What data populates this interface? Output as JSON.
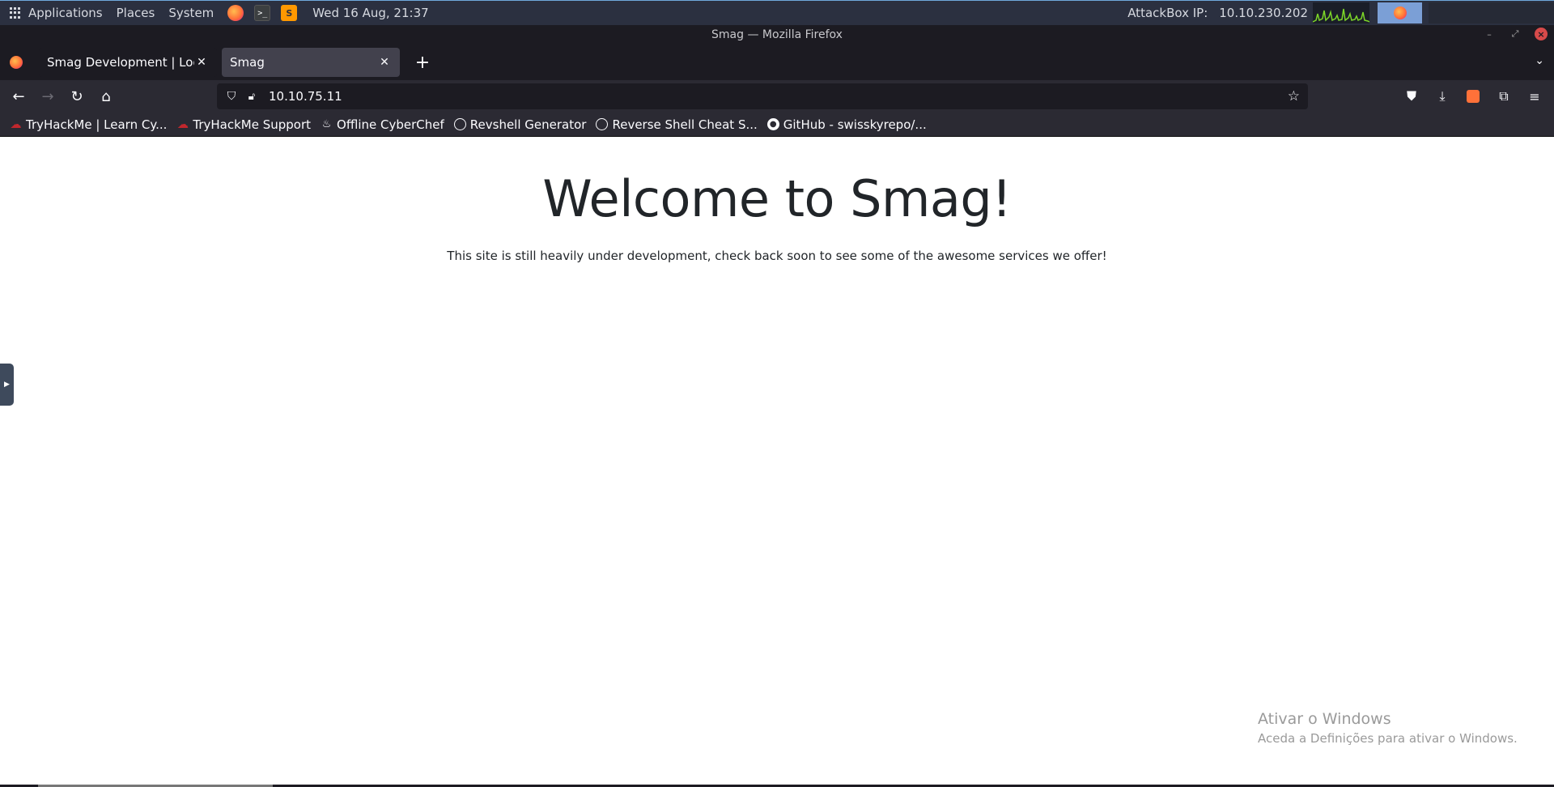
{
  "system_panel": {
    "menus": [
      "Applications",
      "Places",
      "System"
    ],
    "clock": "Wed 16 Aug, 21:37",
    "attackbox_label": "AttackBox IP:",
    "attackbox_ip": "10.10.230.202"
  },
  "window": {
    "title": "Smag — Mozilla Firefox"
  },
  "tabs": [
    {
      "label": "Smag Development | Login",
      "active": false
    },
    {
      "label": "Smag",
      "active": true
    }
  ],
  "url": "10.10.75.11",
  "bookmarks": [
    {
      "label": "TryHackMe | Learn Cy...",
      "icon": "tryhackme-icon"
    },
    {
      "label": "TryHackMe Support",
      "icon": "tryhackme-icon"
    },
    {
      "label": "Offline CyberChef",
      "icon": "chef-hat-icon"
    },
    {
      "label": "Revshell Generator",
      "icon": "globe-icon"
    },
    {
      "label": "Reverse Shell Cheat S...",
      "icon": "globe-icon"
    },
    {
      "label": "GitHub - swisskyrepo/...",
      "icon": "github-icon"
    }
  ],
  "page": {
    "heading": "Welcome to Smag!",
    "text": "This site is still heavily under development, check back soon to see some of the awesome services we offer!"
  },
  "windows_activation": {
    "title": "Ativar o Windows",
    "subtitle": "Aceda a Definições para ativar o Windows."
  },
  "colors": {
    "system_panel": "#2b3040",
    "browser_chrome": "#2b2a33",
    "tab_strip": "#1c1b22",
    "active_tab": "#42414d",
    "heading_text": "#212529"
  }
}
